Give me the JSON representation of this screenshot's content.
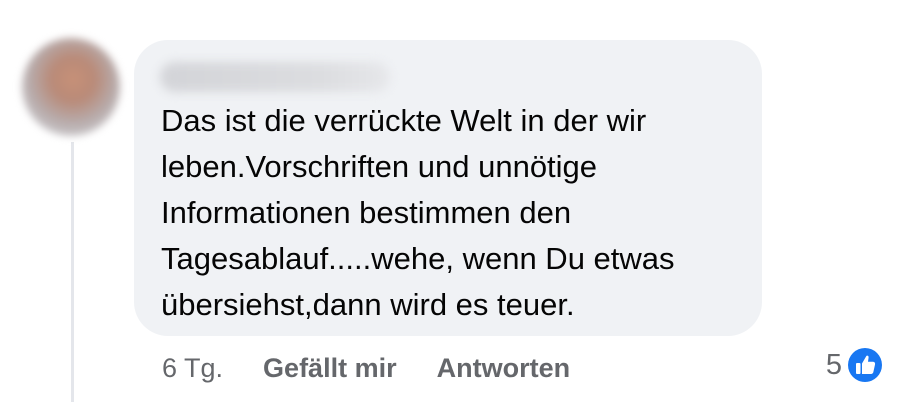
{
  "comment": {
    "text": "Das ist die verrückte Welt in der wir\nleben.Vorschriften und unnötige\nInformationen bestimmen den\nTagesablauf.....wehe, wenn Du etwas\nübersiehst,dann wird es teuer."
  },
  "actions": {
    "time": "6 Tg.",
    "like_label": "Gefällt mir",
    "reply_label": "Antworten"
  },
  "reactions": {
    "count": "5",
    "icon": "like-icon",
    "color": "#1877f2"
  },
  "colors": {
    "bubble": "#f0f2f5",
    "meta_text": "#65676b",
    "body_text": "#050505"
  }
}
